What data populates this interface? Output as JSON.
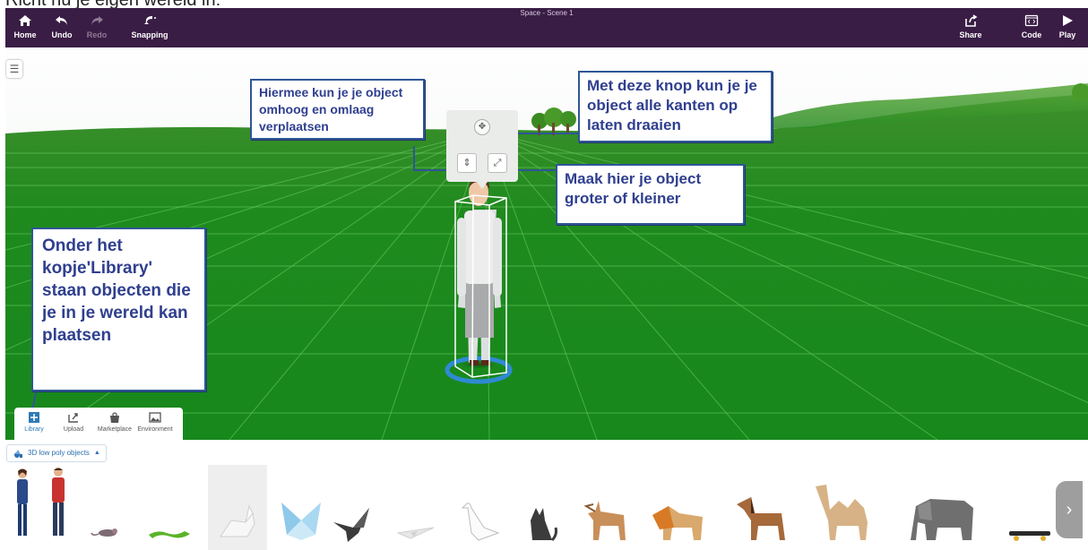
{
  "heading": "Richt nu je eigen wereld in:",
  "window_title": "Space - Scene 1",
  "toolbar": {
    "home": "Home",
    "undo": "Undo",
    "redo": "Redo",
    "snapping": "Snapping",
    "share": "Share",
    "code": "Code",
    "play": "Play"
  },
  "callouts": {
    "move": "Hiermee kun je je object omhoog en omlaag verplaatsen",
    "rotate": "Met deze knop kun je je object alle kanten op laten draaien",
    "scale": "Maak hier je object groter of kleiner",
    "library": "Onder het kopje'Library' staan objecten die je in je wereld kan plaatsen"
  },
  "tabs": [
    {
      "label": "Library",
      "icon": "library-icon",
      "active": true
    },
    {
      "label": "Upload",
      "icon": "upload-icon",
      "active": false
    },
    {
      "label": "Marketplace",
      "icon": "bag-icon",
      "active": false
    },
    {
      "label": "Environment",
      "icon": "image-icon",
      "active": false
    }
  ],
  "library": {
    "category": "3D low poly objects",
    "items": [
      "woman",
      "man",
      "mouse",
      "lizard",
      "rabbit",
      "butterfly",
      "crane",
      "plane",
      "swan",
      "cat",
      "deer",
      "lion",
      "horse",
      "camel",
      "elephant",
      "skateboard"
    ]
  },
  "colors": {
    "toolbar": "#3a1d45",
    "grass": "#1f8a1f",
    "callout_border": "#2f5597",
    "callout_text": "#2f3f8f",
    "accent": "#2d7ab8"
  }
}
